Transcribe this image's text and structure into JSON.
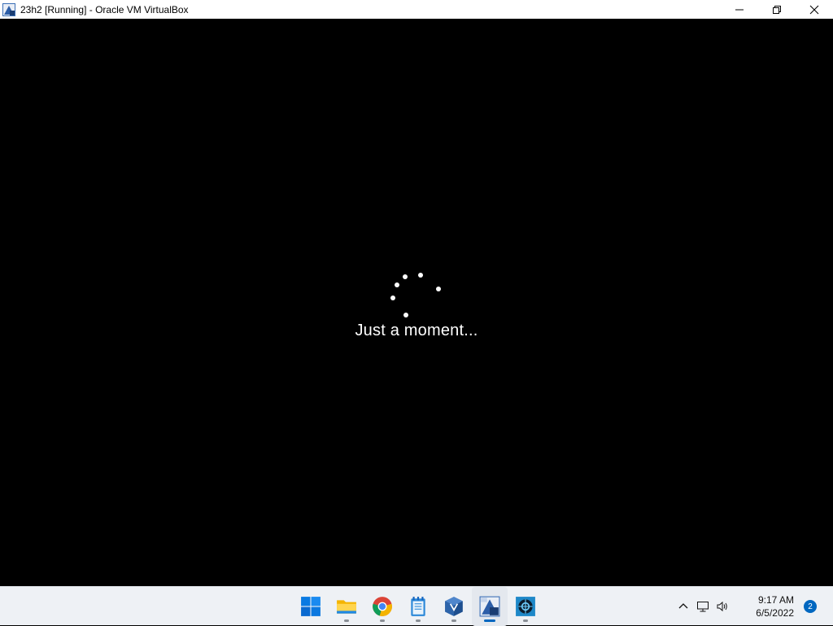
{
  "window": {
    "title": "23h2 [Running] - Oracle VM VirtualBox",
    "icon": "virtualbox-vm-icon",
    "controls": [
      "minimize-icon",
      "restore-icon",
      "close-icon"
    ]
  },
  "vm": {
    "background": "#000000",
    "status_text": "Just a moment...",
    "spinner": "loading-dots"
  },
  "taskbar": {
    "apps": [
      {
        "name": "start",
        "icon": "windows-start-icon"
      },
      {
        "name": "file-explorer",
        "icon": "folder-icon"
      },
      {
        "name": "chrome",
        "icon": "chrome-icon"
      },
      {
        "name": "notepad",
        "icon": "notepad-icon"
      },
      {
        "name": "virtualbox",
        "icon": "virtualbox-icon"
      },
      {
        "name": "virtualbox-vm",
        "icon": "vm-window-icon",
        "active": true
      },
      {
        "name": "app",
        "icon": "app-icon"
      }
    ],
    "tray": {
      "icons": [
        "chevron-up-icon",
        "network-icon",
        "volume-icon"
      ],
      "time": "9:17 AM",
      "date": "6/5/2022",
      "notification_count": "2"
    },
    "accent": "#0067c0"
  }
}
